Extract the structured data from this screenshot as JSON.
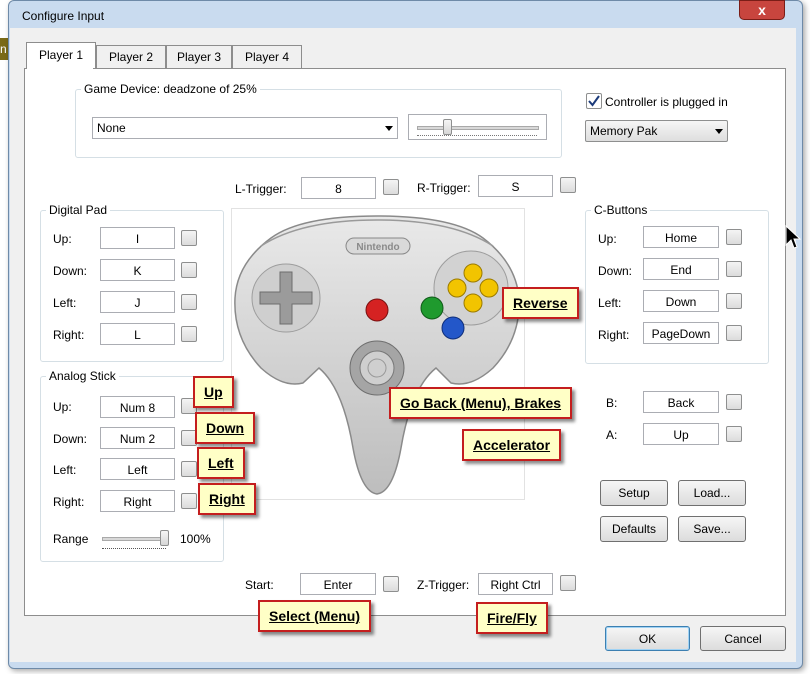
{
  "window": {
    "title": "Configure Input",
    "close_label": "x",
    "side_text": "n"
  },
  "tabs": [
    "Player 1",
    "Player 2",
    "Player 3",
    "Player 4"
  ],
  "game_device": {
    "label": "Game Device: deadzone of 25%",
    "device_value": "None",
    "deadzone_percent": 25
  },
  "controller": {
    "plugged_label": "Controller is plugged in",
    "plugged_checked": true,
    "pak_value": "Memory Pak",
    "brand": "Nintendo"
  },
  "triggers": {
    "l_label": "L-Trigger:",
    "l_value": "8",
    "r_label": "R-Trigger:",
    "r_value": "S",
    "z_label": "Z-Trigger:",
    "z_value": "Right Ctrl",
    "start_label": "Start:",
    "start_value": "Enter"
  },
  "digital_pad": {
    "title": "Digital Pad",
    "rows": [
      {
        "label": "Up:",
        "value": "I"
      },
      {
        "label": "Down:",
        "value": "K"
      },
      {
        "label": "Left:",
        "value": "J"
      },
      {
        "label": "Right:",
        "value": "L"
      }
    ]
  },
  "analog_stick": {
    "title": "Analog Stick",
    "rows": [
      {
        "label": "Up:",
        "value": "Num 8"
      },
      {
        "label": "Down:",
        "value": "Num 2"
      },
      {
        "label": "Left:",
        "value": "Left"
      },
      {
        "label": "Right:",
        "value": "Right"
      }
    ],
    "range_label": "Range",
    "range_value": "100%",
    "range_fraction": 1.0
  },
  "c_buttons": {
    "title": "C-Buttons",
    "rows": [
      {
        "label": "Up:",
        "value": "Home"
      },
      {
        "label": "Down:",
        "value": "End"
      },
      {
        "label": "Left:",
        "value": "Down"
      },
      {
        "label": "Right:",
        "value": "PageDown"
      }
    ]
  },
  "ab_buttons": {
    "b_label": "B:",
    "b_value": "Back",
    "a_label": "A:",
    "a_value": "Up"
  },
  "buttons": {
    "setup": "Setup",
    "load": "Load...",
    "defaults": "Defaults",
    "save": "Save...",
    "ok": "OK",
    "cancel": "Cancel"
  },
  "callouts": {
    "reverse": "Reverse",
    "up": "Up",
    "down": "Down",
    "left": "Left",
    "right": "Right",
    "go_back": "Go Back (Menu), Brakes",
    "accelerator": "Accelerator",
    "select": "Select (Menu)",
    "fire": "Fire/Fly"
  },
  "colors": {
    "callout_fill": "#ffffc6",
    "callout_border": "#c41e1e",
    "button_red": "#d52222",
    "button_green": "#1f9a2e",
    "button_blue": "#2357c9",
    "button_yellow": "#f2c400"
  }
}
